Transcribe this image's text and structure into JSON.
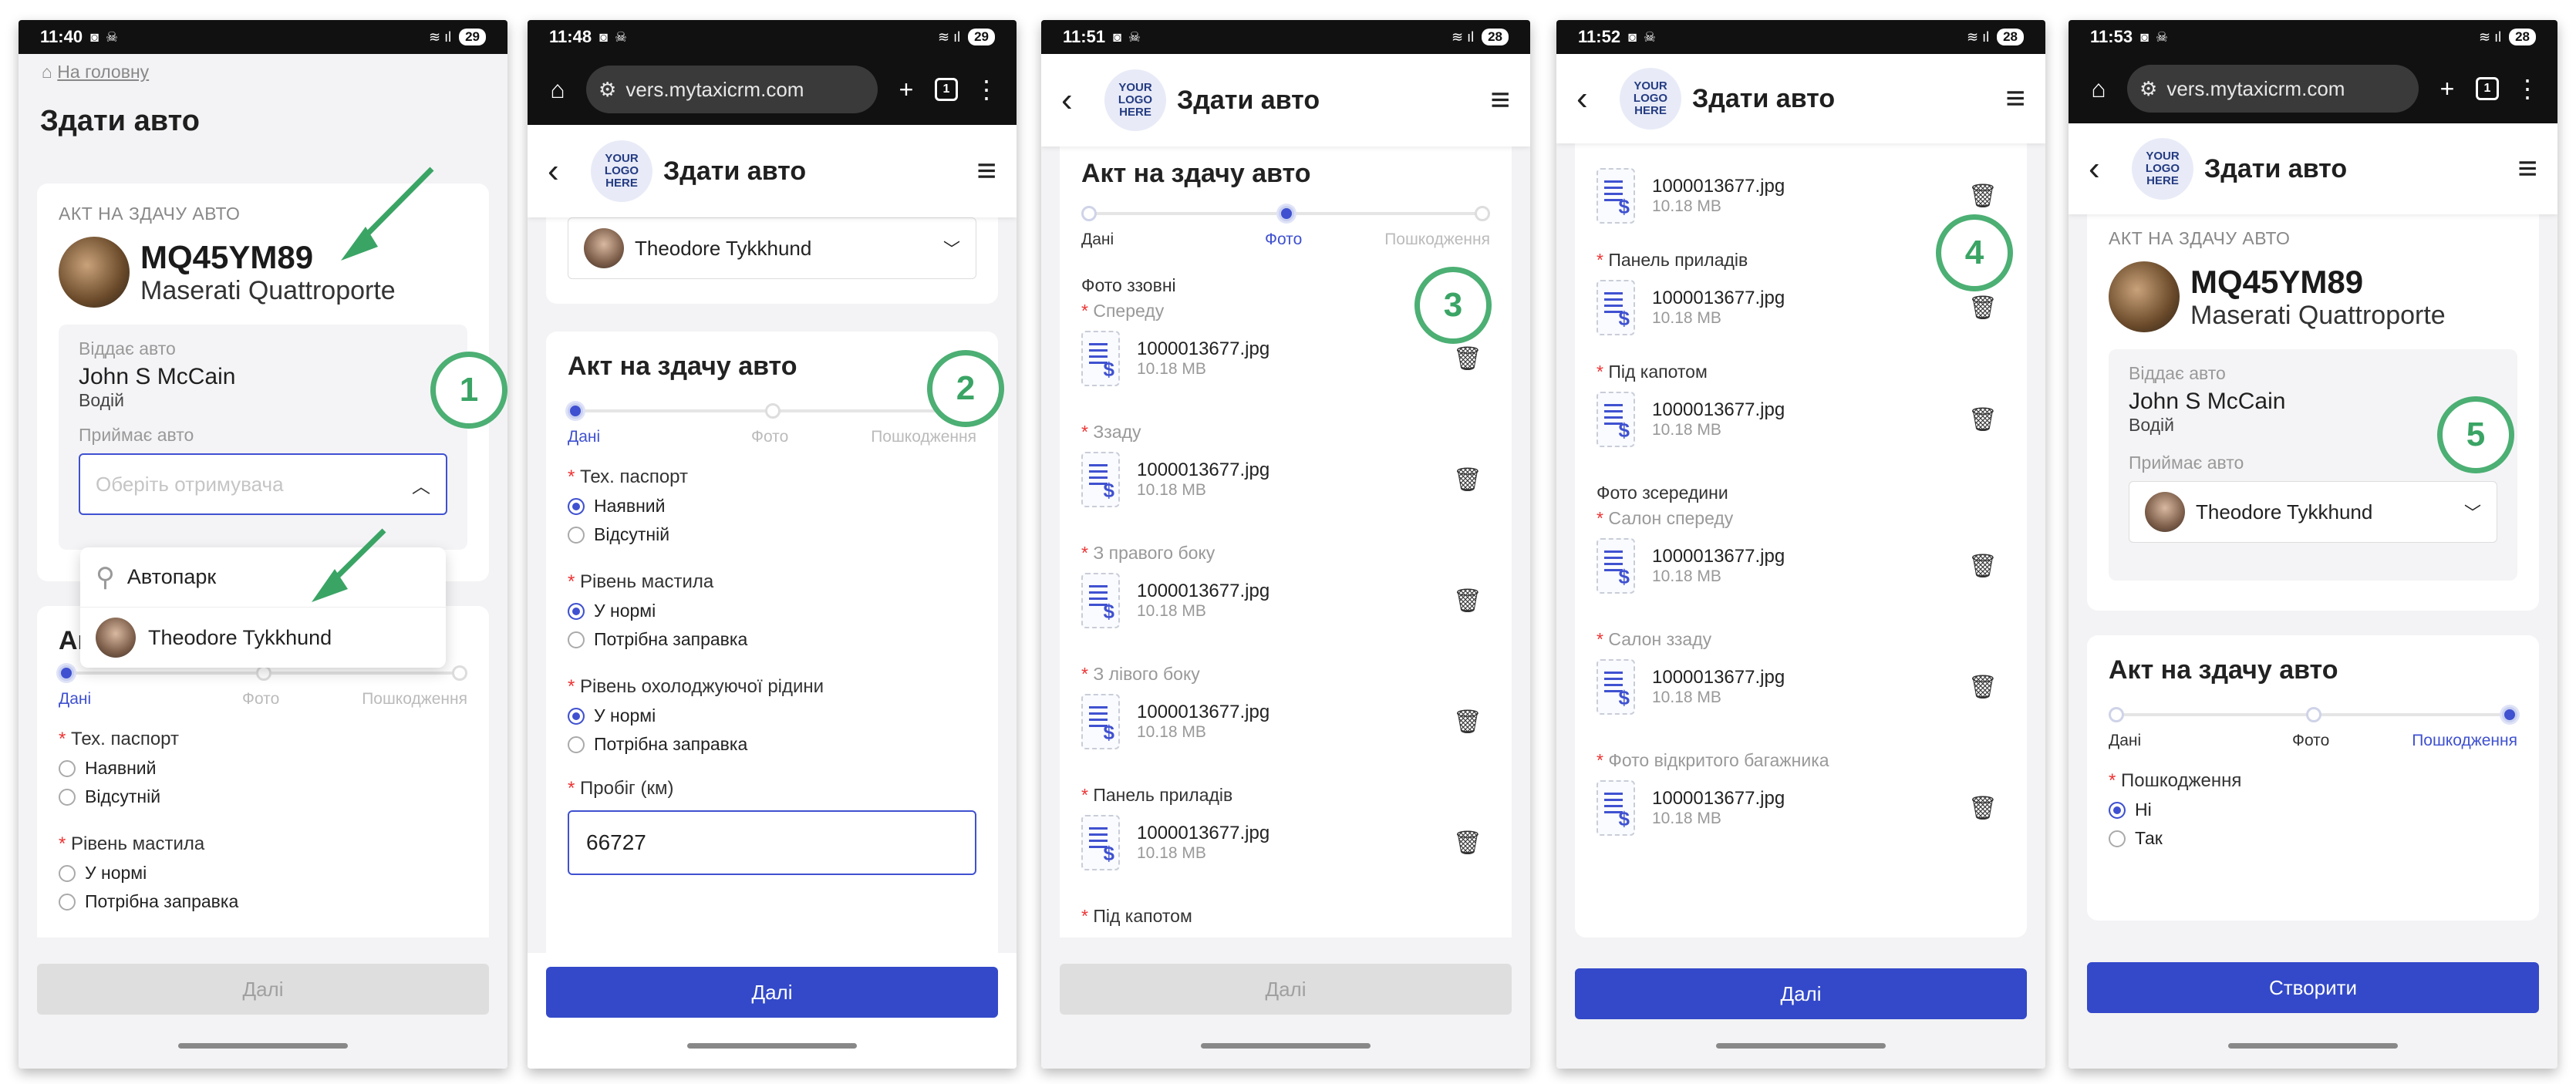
{
  "common": {
    "page_title": "Здати авто",
    "logo_text": "YOUR LOGO HERE",
    "act_title": "Акт на здачу авто",
    "act_caption": "АКТ НА ЗДАЧУ АВТО",
    "plate": "MQ45YM89",
    "model": "Maserati Quattroporte",
    "gives_label": "Віддає авто",
    "gives_name": "John S McCain",
    "gives_role": "Водій",
    "receives_label": "Приймає авто",
    "receiver_name": "Theodore Tykkhund",
    "steps": [
      "Дані",
      "Фото",
      "Пошкодження"
    ],
    "next": "Далі",
    "create": "Створити",
    "url": "vers.mytaxicrm.com",
    "file_name": "1000013677.jpg",
    "file_size": "10.18 MB"
  },
  "p1": {
    "time": "11:40",
    "battery": "29",
    "home_link": "На головну",
    "select_placeholder": "Оберіть отримувача",
    "options": [
      "Автопарк",
      "Theodore Tykkhund"
    ],
    "badge": "1"
  },
  "p2": {
    "time": "11:48",
    "battery": "29",
    "badge": "2",
    "mileage_label": "Пробіг (км)",
    "mileage_value": "66727"
  },
  "p3": {
    "time": "11:51",
    "battery": "28",
    "badge": "3",
    "section_out": "Фото ззовні"
  },
  "p4": {
    "time": "11:52",
    "battery": "28",
    "badge": "4",
    "section_in": "Фото зсередини"
  },
  "p5": {
    "time": "11:53",
    "battery": "28",
    "badge": "5",
    "damage_label": "Пошкодження",
    "damage_no": "Ні",
    "damage_yes": "Так"
  },
  "fields": {
    "passport": "Тех. паспорт",
    "present": "Наявний",
    "absent": "Відсутній",
    "oil": "Рівень мастила",
    "normal": "У нормі",
    "refill": "Потрібна заправка",
    "coolant": "Рівень охолоджуючої рідини"
  },
  "photos": {
    "front": "Спереду",
    "back": "Ззаду",
    "right": "З правого боку",
    "left": "З лівого боку",
    "dashboard": "Панель приладів",
    "hood": "Під капотом",
    "salon_front": "Салон спереду",
    "salon_back": "Салон ззаду",
    "trunk": "Фото відкритого багажника"
  }
}
